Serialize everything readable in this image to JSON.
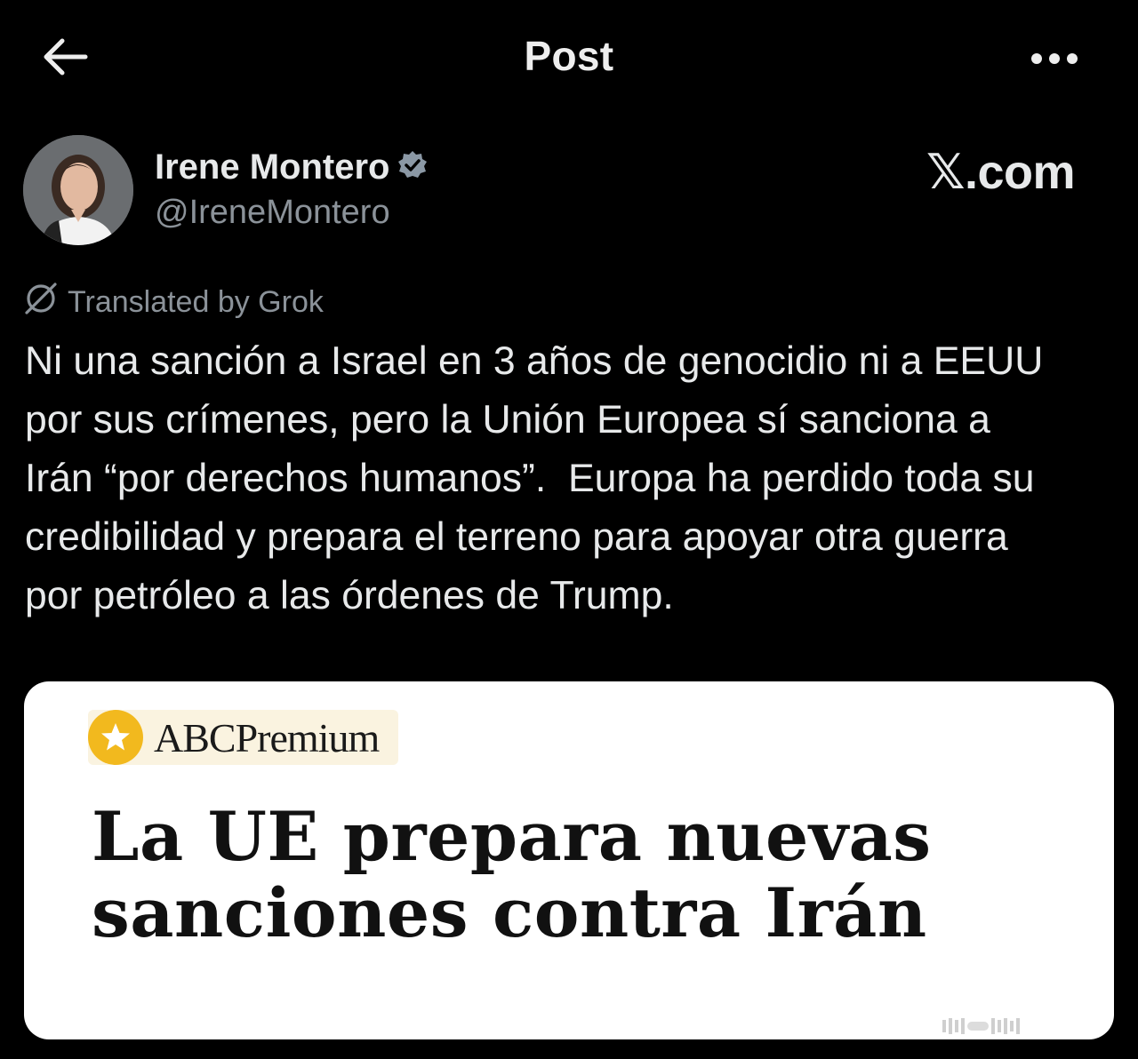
{
  "header": {
    "title": "Post",
    "back_icon": "arrow-left-icon",
    "more_icon": "more-horizontal-icon"
  },
  "author": {
    "display_name": "Irene Montero",
    "handle": "@IreneMontero",
    "verified_icon": "verified-badge-icon",
    "verified_color": "#8b98a5"
  },
  "watermark": {
    "text": "𝕏.com"
  },
  "translation": {
    "label": "Translated by Grok",
    "icon": "grok-icon"
  },
  "post": {
    "text": "Ni una sanción a Israel en 3 años de genocidio ni a EEUU\npor sus crímenes, pero la Unión Europea sí sanciona a\nIrán “por derechos humanos”.  Europa ha perdido toda su\ncredibilidad y prepara el terreno para apoyar otra guerra\npor petróleo a las órdenes de Trump."
  },
  "media": {
    "brand_abc": "ABC",
    "brand_premium": "Premium",
    "star_icon": "star-icon",
    "star_color": "#f2b91e",
    "headline_line1": "La UE prepara nuevas",
    "headline_line2": "sanciones contra Irán"
  },
  "colors": {
    "background": "#000000",
    "primary_text": "#e7e9ea",
    "secondary_text": "#8b9299"
  }
}
